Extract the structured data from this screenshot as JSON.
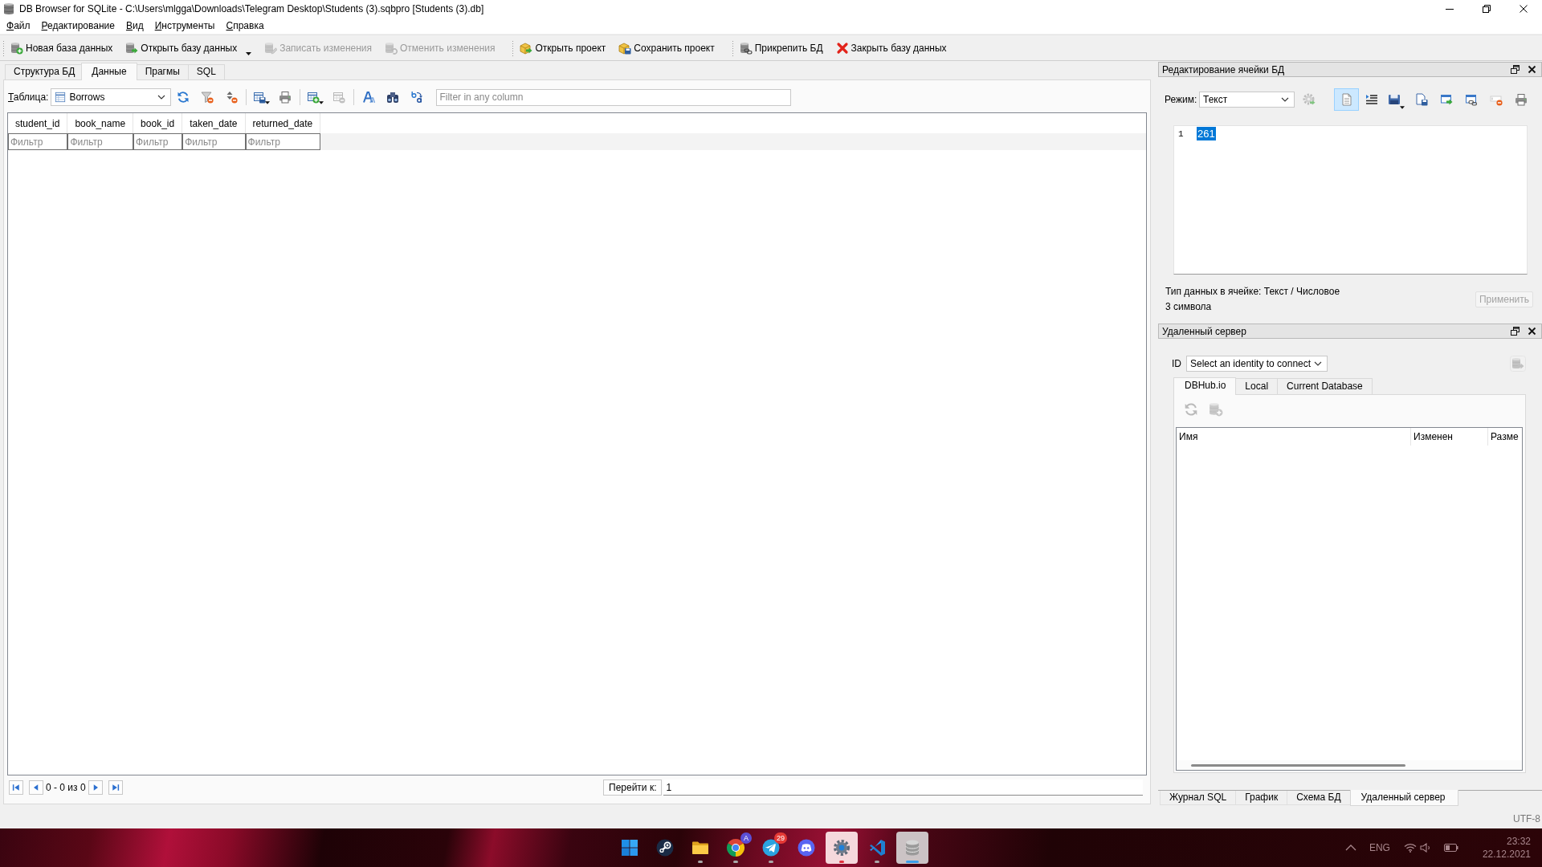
{
  "window": {
    "title": "DB Browser for SQLite - C:\\Users\\mlgga\\Downloads\\Telegram Desktop\\Students (3).sqbpro [Students (3).db]"
  },
  "menu": [
    {
      "label": "Файл"
    },
    {
      "label": "Редактирование"
    },
    {
      "label": "Вид"
    },
    {
      "label": "Инструменты"
    },
    {
      "label": "Справка"
    }
  ],
  "toolbar_groups": [
    {
      "buttons": [
        {
          "label": "Новая база данных",
          "disabled": false,
          "dropdown": false
        },
        {
          "label": "Открыть базу данных",
          "disabled": false,
          "dropdown": true
        },
        {
          "label": "Записать изменения",
          "disabled": true,
          "dropdown": false
        },
        {
          "label": "Отменить изменения",
          "disabled": true,
          "dropdown": false
        }
      ]
    },
    {
      "buttons": [
        {
          "label": "Открыть проект",
          "disabled": false,
          "dropdown": false
        },
        {
          "label": "Сохранить проект",
          "disabled": false,
          "dropdown": false
        }
      ]
    },
    {
      "buttons": [
        {
          "label": "Прикрепить БД",
          "disabled": false,
          "dropdown": false
        },
        {
          "label": "Закрыть базу данных",
          "disabled": false,
          "dropdown": false
        }
      ]
    }
  ],
  "main_tabs": [
    {
      "label": "Структура БД",
      "selected": false
    },
    {
      "label": "Данные",
      "selected": true
    },
    {
      "label": "Прагмы",
      "selected": false
    },
    {
      "label": "SQL",
      "selected": false
    }
  ],
  "browse": {
    "table_label": "Таблица:",
    "table_value": "Borrows",
    "tool_groups": [
      {
        "tools": [
          {
            "disabled": false,
            "dropdown": false
          },
          {
            "disabled": false,
            "dropdown": false
          },
          {
            "disabled": false,
            "dropdown": false
          }
        ]
      },
      {
        "tools": [
          {
            "disabled": false,
            "dropdown": true
          },
          {
            "disabled": false,
            "dropdown": false
          }
        ]
      },
      {
        "tools": [
          {
            "disabled": false,
            "dropdown": true
          },
          {
            "disabled": true,
            "dropdown": false
          }
        ]
      },
      {
        "tools": [
          {
            "disabled": false,
            "dropdown": false
          },
          {
            "disabled": false,
            "dropdown": false
          },
          {
            "disabled": false,
            "dropdown": false
          }
        ]
      }
    ],
    "filter_placeholder": "Filter in any column",
    "columns": [
      {
        "name": "student_id",
        "filter_placeholder": "Фильтр"
      },
      {
        "name": "book_name",
        "filter_placeholder": "Фильтр"
      },
      {
        "name": "book_id",
        "filter_placeholder": "Фильтр"
      },
      {
        "name": "taken_date",
        "filter_placeholder": "Фильтр"
      },
      {
        "name": "returned_date",
        "filter_placeholder": "Фильтр"
      }
    ],
    "range": "0 - 0 из 0",
    "goto_label": "Перейти к:",
    "goto_value": "1"
  },
  "cell_editor": {
    "title": "Редактирование ячейки БД",
    "mode_label": "Режим:",
    "mode_value": "Текст",
    "tools": [
      {
        "disabled": true,
        "selected": false,
        "dropdown": false
      },
      {
        "disabled": false,
        "selected": true,
        "dropdown": false
      },
      {
        "disabled": false,
        "selected": false,
        "dropdown": false
      },
      {
        "disabled": false,
        "selected": false,
        "dropdown": true
      },
      {
        "disabled": false,
        "selected": false,
        "dropdown": false
      },
      {
        "disabled": false,
        "selected": false,
        "dropdown": false
      },
      {
        "disabled": false,
        "selected": false,
        "dropdown": false
      },
      {
        "disabled": false,
        "selected": false,
        "dropdown": false
      },
      {
        "disabled": false,
        "selected": false,
        "dropdown": false
      }
    ],
    "line_number": "1",
    "content": "261",
    "content_selected": true,
    "type_info": "Тип данных в ячейке: Текст / Числовое",
    "size_info": "3 символа",
    "apply": {
      "label": "Применить",
      "disabled": true
    }
  },
  "remote_server": {
    "title": "Удаленный сервер",
    "id_label": "ID",
    "identity_value": "Select an identity to connect",
    "push_disabled": true,
    "tabs": [
      {
        "label": "DBHub.io",
        "selected": true
      },
      {
        "label": "Local",
        "selected": false
      },
      {
        "label": "Current Database",
        "selected": false
      }
    ],
    "tools": [
      {
        "disabled": true
      },
      {
        "disabled": true
      }
    ],
    "columns": [
      {
        "name": "Имя"
      },
      {
        "name": "Изменен"
      },
      {
        "name": "Разме"
      }
    ]
  },
  "dock_tabs": [
    {
      "label": "Журнал SQL",
      "selected": false
    },
    {
      "label": "График",
      "selected": false
    },
    {
      "label": "Схема БД",
      "selected": false
    },
    {
      "label": "Удаленный сервер",
      "selected": true
    }
  ],
  "status_bar": {
    "encoding": "UTF-8"
  },
  "taskbar": {
    "apps": [
      {
        "running": false,
        "selected": false,
        "attention": false
      },
      {
        "running": false,
        "selected": false,
        "attention": false
      },
      {
        "running": true,
        "selected": false,
        "attention": false
      },
      {
        "running": true,
        "selected": false,
        "attention": false,
        "badge": {
          "text": "A",
          "color": "#5b4fd6"
        }
      },
      {
        "running": true,
        "selected": false,
        "attention": false,
        "badge": {
          "text": "29",
          "color": "#e53935"
        }
      },
      {
        "running": false,
        "selected": false,
        "attention": false
      },
      {
        "running": true,
        "selected": false,
        "attention": true
      },
      {
        "running": true,
        "selected": false,
        "attention": false
      },
      {
        "running": true,
        "selected": true,
        "attention": false
      }
    ],
    "tray": {
      "language": "ENG",
      "time": "23:32",
      "date": "22.12.2021"
    }
  }
}
